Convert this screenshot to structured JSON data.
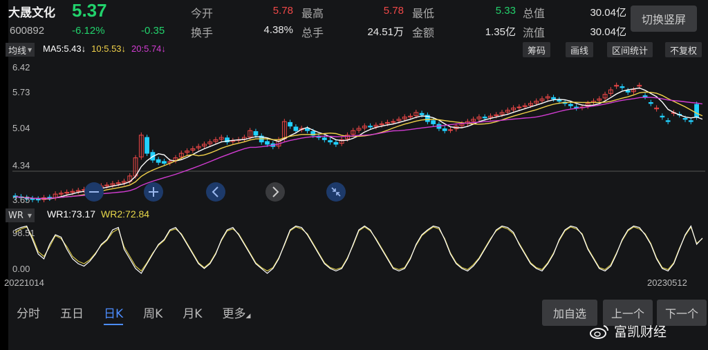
{
  "header": {
    "name": "大晟文化",
    "price": "5.37",
    "code": "600892",
    "change_pct": "-6.12%",
    "change_amt": "-0.35",
    "quotes": [
      {
        "label": "今开",
        "value": "5.78",
        "color": "#f04848"
      },
      {
        "label": "最高",
        "value": "5.78",
        "color": "#f04848"
      },
      {
        "label": "最低",
        "value": "5.33",
        "color": "#22d26c"
      },
      {
        "label": "总值",
        "value": "30.04亿",
        "color": "#e8e8e8"
      },
      {
        "label": "换手",
        "value": "4.38%",
        "color": "#e8e8e8"
      },
      {
        "label": "总手",
        "value": "24.51万",
        "color": "#e8e8e8"
      },
      {
        "label": "金额",
        "value": "1.35亿",
        "color": "#e8e8e8"
      },
      {
        "label": "流值",
        "value": "30.04亿",
        "color": "#e8e8e8"
      }
    ],
    "switch_label": "切换竖屏"
  },
  "toolbar": {
    "ma_dropdown": "均线",
    "ma5": "MA5:5.43↓",
    "ma10": "10:5.53↓",
    "ma20": "20:5.74↓",
    "buttons": [
      "筹码",
      "画线",
      "区间统计",
      "不复权"
    ]
  },
  "wr": {
    "dropdown": "WR",
    "wr1": "WR1:73.17",
    "wr2": "WR2:72.84",
    "y_top": "98.51",
    "y_bottom": "0.00"
  },
  "dates": {
    "start": "20221014",
    "end": "20230512"
  },
  "tabs": [
    {
      "label": "分时",
      "active": false
    },
    {
      "label": "五日",
      "active": false
    },
    {
      "label": "日K",
      "active": true
    },
    {
      "label": "周K",
      "active": false
    },
    {
      "label": "月K",
      "active": false
    },
    {
      "label": "更多",
      "active": false
    }
  ],
  "bottom_buttons": [
    "加自选",
    "上一个",
    "下一个"
  ],
  "watermark": "富凯财经",
  "colors": {
    "up": "#f04848",
    "down": "#22d0ff",
    "ma5": "#ffffff",
    "ma10": "#f2d24a",
    "ma20": "#d23cd2",
    "wr1": "#ffffff",
    "wr2": "#d8c84a"
  },
  "chart_data": {
    "type": "candlestick",
    "ylim": [
      3.65,
      6.62
    ],
    "y_ticks": [
      "6.42",
      "5.73",
      "5.04",
      "4.34",
      "3.65"
    ],
    "closes": [
      3.74,
      3.72,
      3.7,
      3.68,
      3.67,
      3.72,
      3.71,
      3.8,
      3.82,
      3.84,
      3.86,
      3.88,
      3.9,
      3.92,
      3.95,
      3.98,
      4.0,
      4.03,
      4.05,
      4.08,
      4.2,
      4.6,
      5.1,
      4.7,
      4.55,
      4.5,
      4.48,
      4.52,
      4.6,
      4.7,
      4.75,
      4.8,
      4.85,
      4.9,
      4.95,
      5.0,
      5.05,
      4.95,
      4.98,
      5.0,
      5.05,
      5.2,
      5.1,
      4.95,
      4.9,
      4.85,
      5.0,
      5.4,
      5.3,
      5.2,
      5.25,
      5.2,
      5.1,
      5.05,
      5.0,
      4.95,
      4.9,
      5.0,
      5.1,
      5.2,
      5.25,
      5.3,
      5.28,
      5.32,
      5.35,
      5.38,
      5.4,
      5.45,
      5.5,
      5.52,
      5.6,
      5.55,
      5.4,
      5.35,
      5.25,
      5.2,
      5.22,
      5.3,
      5.35,
      5.4,
      5.45,
      5.5,
      5.48,
      5.52,
      5.55,
      5.6,
      5.65,
      5.7,
      5.72,
      5.75,
      5.8,
      5.85,
      5.9,
      5.95,
      5.9,
      5.85,
      5.8,
      5.75,
      5.7,
      5.72,
      5.8,
      5.85,
      5.9,
      6.0,
      6.1,
      6.2,
      6.15,
      6.05,
      6.1,
      6.2,
      5.95,
      5.8,
      5.7,
      5.5,
      5.4,
      5.6,
      5.55,
      5.45,
      5.4,
      5.5,
      5.37
    ],
    "opens": [
      3.76,
      3.74,
      3.72,
      3.7,
      3.69,
      3.68,
      3.73,
      3.72,
      3.8,
      3.82,
      3.84,
      3.86,
      3.88,
      3.9,
      3.92,
      3.95,
      3.98,
      4.0,
      4.03,
      4.05,
      4.08,
      4.2,
      4.62,
      5.05,
      4.72,
      4.56,
      4.52,
      4.49,
      4.54,
      4.62,
      4.72,
      4.77,
      4.82,
      4.86,
      4.91,
      4.96,
      5.01,
      5.04,
      4.96,
      4.99,
      5.01,
      5.06,
      5.18,
      5.08,
      4.96,
      4.91,
      4.86,
      5.02,
      5.38,
      5.28,
      5.22,
      5.24,
      5.18,
      5.08,
      5.04,
      4.98,
      4.94,
      4.92,
      5.02,
      5.12,
      5.21,
      5.26,
      5.3,
      5.29,
      5.33,
      5.36,
      5.39,
      5.42,
      5.46,
      5.5,
      5.53,
      5.58,
      5.54,
      5.42,
      5.34,
      5.24,
      5.21,
      5.24,
      5.31,
      5.36,
      5.41,
      5.46,
      5.5,
      5.49,
      5.53,
      5.56,
      5.61,
      5.66,
      5.71,
      5.73,
      5.76,
      5.81,
      5.86,
      5.92,
      5.93,
      5.88,
      5.83,
      5.78,
      5.72,
      5.71,
      5.74,
      5.82,
      5.87,
      5.92,
      6.02,
      6.18,
      6.17,
      6.08,
      6.06,
      6.18,
      5.97,
      5.82,
      5.68,
      5.52,
      5.42,
      5.58,
      5.56,
      5.47,
      5.42,
      5.78
    ],
    "wr1": [
      90,
      95,
      98,
      70,
      40,
      30,
      60,
      80,
      75,
      50,
      30,
      20,
      15,
      25,
      40,
      60,
      70,
      90,
      95,
      50,
      30,
      10,
      0,
      20,
      40,
      60,
      70,
      90,
      95,
      80,
      60,
      40,
      20,
      10,
      20,
      40,
      70,
      90,
      95,
      80,
      60,
      40,
      20,
      10,
      0,
      10,
      30,
      60,
      90,
      98,
      95,
      80,
      60,
      40,
      20,
      10,
      5,
      10,
      30,
      60,
      90,
      98,
      90,
      70,
      50,
      30,
      10,
      5,
      10,
      30,
      60,
      80,
      90,
      98,
      95,
      70,
      40,
      20,
      10,
      5,
      15,
      30,
      50,
      70,
      90,
      98,
      95,
      85,
      60,
      40,
      20,
      10,
      5,
      20,
      40,
      70,
      90,
      98,
      95,
      80,
      50,
      30,
      10,
      5,
      15,
      40,
      70,
      90,
      98,
      95,
      80,
      60,
      30,
      10,
      5,
      20,
      50,
      80,
      98,
      60,
      73
    ],
    "wr2": [
      85,
      92,
      96,
      75,
      45,
      35,
      55,
      78,
      72,
      55,
      35,
      25,
      20,
      28,
      42,
      58,
      68,
      85,
      92,
      55,
      35,
      15,
      5,
      22,
      42,
      58,
      68,
      88,
      92,
      82,
      62,
      42,
      22,
      12,
      22,
      42,
      68,
      88,
      92,
      82,
      62,
      42,
      22,
      12,
      5,
      12,
      32,
      58,
      88,
      96,
      92,
      82,
      62,
      42,
      22,
      12,
      8,
      12,
      32,
      58,
      88,
      96,
      88,
      72,
      52,
      32,
      12,
      8,
      12,
      32,
      58,
      78,
      88,
      96,
      92,
      72,
      42,
      22,
      12,
      8,
      18,
      32,
      52,
      72,
      88,
      96,
      92,
      82,
      62,
      42,
      22,
      12,
      8,
      22,
      42,
      68,
      88,
      96,
      92,
      82,
      52,
      32,
      12,
      8,
      18,
      42,
      68,
      88,
      96,
      92,
      82,
      62,
      32,
      12,
      8,
      22,
      52,
      78,
      96,
      62,
      72
    ]
  }
}
